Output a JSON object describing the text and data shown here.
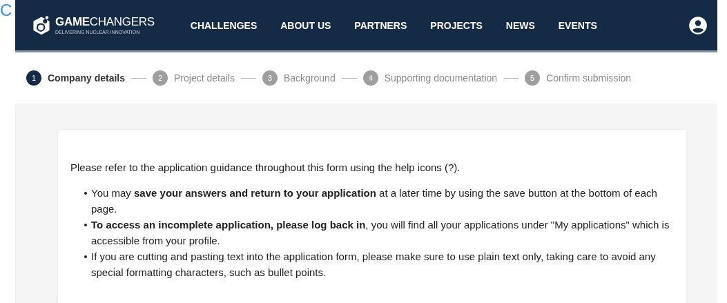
{
  "page_fragment": "C",
  "navbar": {
    "logo": {
      "name": "**GAME**CHANGERS",
      "tagline": "DELIVERING NUCLEAR INNOVATION"
    },
    "links": [
      {
        "label": "CHALLENGES"
      },
      {
        "label": "ABOUT US"
      },
      {
        "label": "PARTNERS"
      },
      {
        "label": "PROJECTS"
      },
      {
        "label": "NEWS"
      },
      {
        "label": "EVENTS"
      }
    ]
  },
  "stepper": [
    {
      "number": "1",
      "label": "Company details",
      "selected": true
    },
    {
      "number": "2",
      "label": "Project details",
      "selected": false
    },
    {
      "number": "3",
      "label": "Background",
      "selected": false
    },
    {
      "number": "4",
      "label": "Supporting documentation",
      "selected": false
    },
    {
      "number": "5",
      "label": "Confirm submission",
      "selected": false
    }
  ],
  "card": {
    "intro": "Please refer to the application guidance throughout this form using the help icons (?).",
    "bullets": [
      "You may **save your answers and return to your application** at a later time by using the save button at the bottom of each page.",
      "**To access an incomplete application, please log back in**, you will find all your applications under \"My applications\" which is accessible from your profile.",
      "If you are cutting and pasting text into the application form, please make sure to use plain text only, taking care to avoid any special formatting characters, such as bullet points."
    ]
  }
}
